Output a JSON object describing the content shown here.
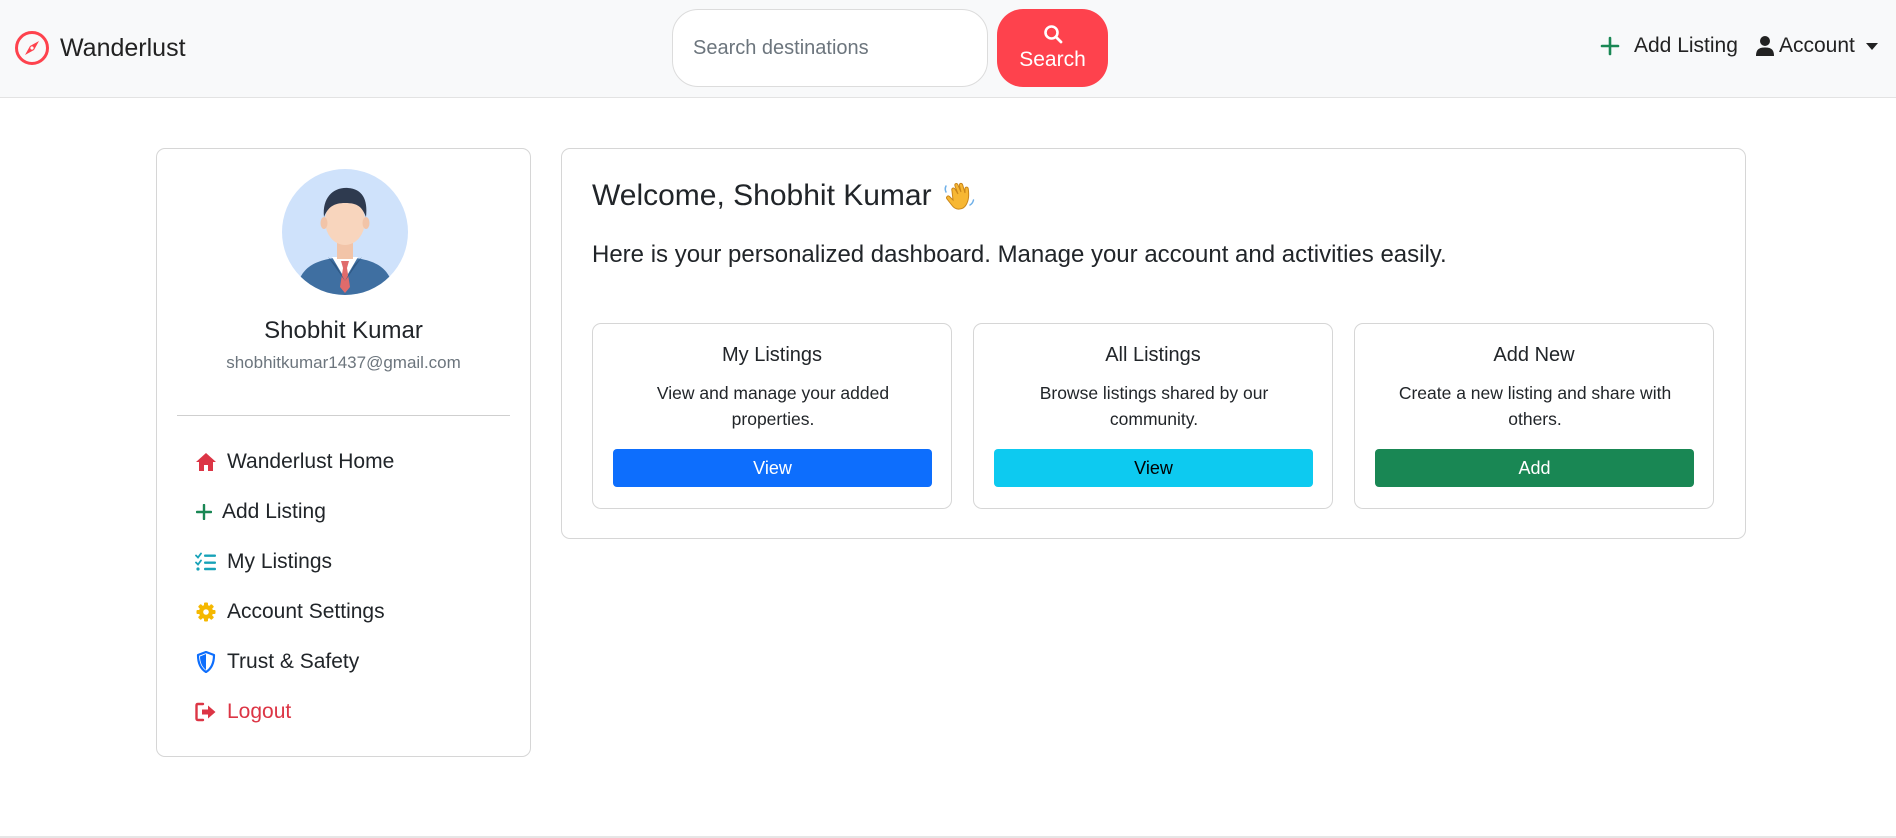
{
  "navbar": {
    "brand": "Wanderlust",
    "search_placeholder": "Search destinations",
    "search_button": "Search",
    "add_listing": "Add Listing",
    "account": "Account",
    "brand_color": "#fe424d"
  },
  "profile": {
    "name": "Shobhit Kumar",
    "email": "shobhitkumar1437@gmail.com"
  },
  "sidebar": {
    "items": [
      {
        "label": "Wanderlust Home",
        "icon": "house-icon"
      },
      {
        "label": "Add Listing",
        "icon": "plus-icon"
      },
      {
        "label": "My Listings",
        "icon": "list-check-icon"
      },
      {
        "label": "Account Settings",
        "icon": "gear-icon"
      },
      {
        "label": "Trust & Safety",
        "icon": "shield-icon"
      },
      {
        "label": "Logout",
        "icon": "logout-icon"
      }
    ]
  },
  "main": {
    "welcome": "Welcome, Shobhit Kumar",
    "subtitle": "Here is your personalized dashboard. Manage your account and activities easily.",
    "cards": [
      {
        "title": "My Listings",
        "description": "View and manage your added properties.",
        "button": "View",
        "button_color": "#0d6efd"
      },
      {
        "title": "All Listings",
        "description": "Browse listings shared by our community.",
        "button": "View",
        "button_color": "#0dcaf0"
      },
      {
        "title": "Add New",
        "description": "Create a new listing and share with others.",
        "button": "Add",
        "button_color": "#198754"
      }
    ]
  }
}
